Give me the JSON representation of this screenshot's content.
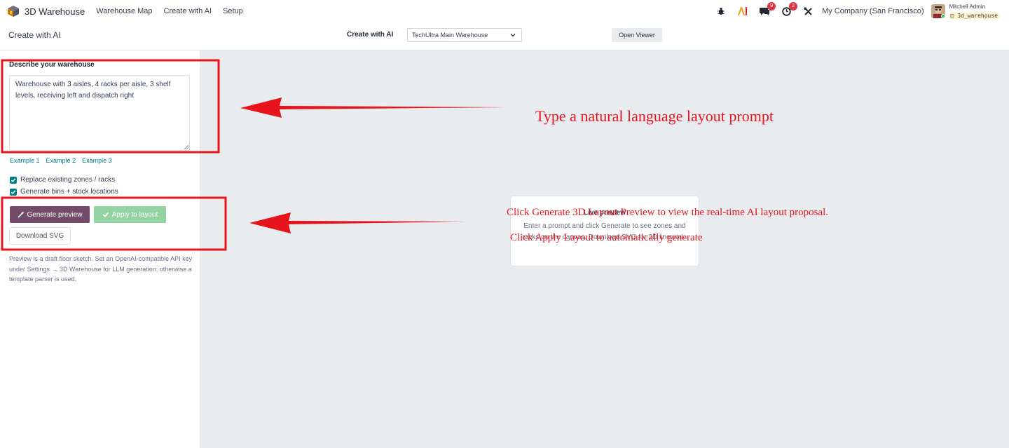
{
  "navbar": {
    "brand": "3D Warehouse",
    "menu": [
      "Warehouse Map",
      "Create with AI",
      "Setup"
    ],
    "messages_badge": "9",
    "activities_badge": "2",
    "company": "My Company (San Francisco)",
    "user_name": "Mitchell Admin",
    "database": "3d_warehouse"
  },
  "control": {
    "page_title": "Create with AI",
    "center_title": "Create with AI",
    "warehouse_selected": "TechUltra Main Warehouse",
    "open_viewer": "Open Viewer"
  },
  "panel": {
    "describe_label": "Describe your warehouse",
    "prompt_value": "Warehouse with 3 aisles, 4 racks per aisle, 3 shelf levels, receiving left and dispatch right",
    "examples": [
      "Example 1",
      "Example 2",
      "Example 3"
    ],
    "replace_label": "Replace existing zones / racks",
    "replace_checked": true,
    "generate_bins_label": "Generate bins + stock locations",
    "generate_bins_checked": true,
    "generate_button": "Generate preview",
    "apply_button": "Apply to layout",
    "download_button": "Download SVG",
    "help_text": "Preview is a draft floor sketch. Set an OpenAI-compatible API key under Settings → 3D Warehouse for LLM generation; otherwise a template parser is used."
  },
  "preview": {
    "title": "Live preview",
    "text": "Enter a prompt and click Generate to see zones and racks on the canvas. Download SVG for 2D linework."
  },
  "annotations": {
    "main": "Type a natural language layout prompt",
    "generate": "Click Generate 3D Layout Preview to view the real-time AI layout proposal.",
    "apply": "Click Apply Layout to automatically generate"
  },
  "colors": {
    "primary": "#714b67",
    "success_disabled": "#94d3a2",
    "link": "#017e84",
    "annotation": "#e8141c",
    "canvas": "#e9ecef"
  }
}
